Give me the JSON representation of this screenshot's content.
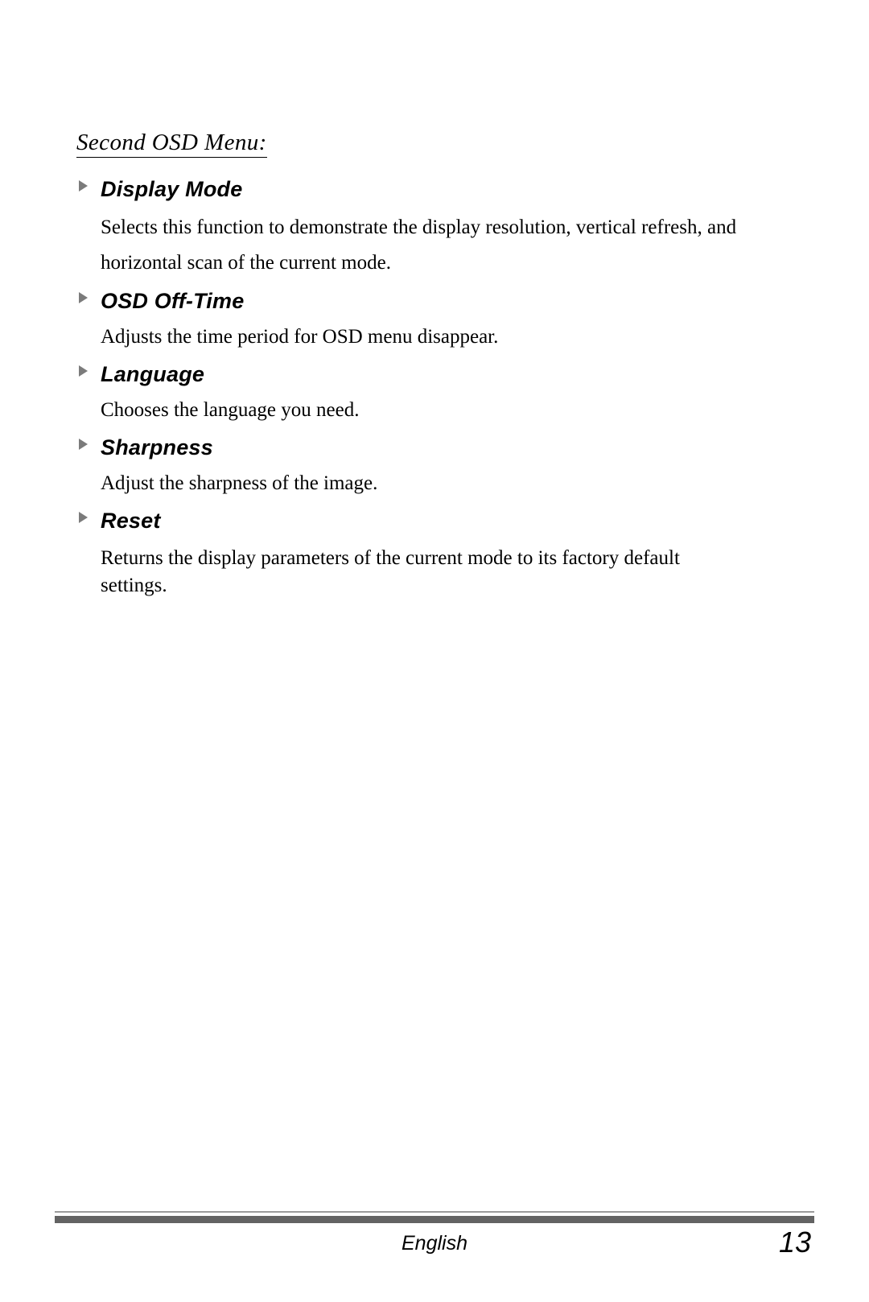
{
  "document": {
    "section_title": "Second OSD Menu:",
    "entries": [
      {
        "heading": "Display Mode",
        "body": "Selects this function to demonstrate the display resolution, vertical refresh, and horizontal scan of the current mode.",
        "bullet": "triangle-right-icon"
      },
      {
        "heading": "OSD Off-Time",
        "body": "Adjusts the time period for OSD menu disappear.",
        "bullet": "triangle-right-icon"
      },
      {
        "heading": "Language",
        "body": "Chooses the language you need.",
        "bullet": "triangle-right-icon"
      },
      {
        "heading": "Sharpness",
        "body": "Adjust the sharpness of the image.",
        "bullet": "triangle-right-icon"
      },
      {
        "heading": "Reset",
        "body": "Returns the display parameters of the current mode to its factory default settings.",
        "bullet": "triangle-right-icon"
      }
    ]
  },
  "footer": {
    "language": "English",
    "page_number": "13"
  },
  "colors": {
    "text": "#000000",
    "bullet_gray": "#7b7b7b",
    "rule_thin": "#9b9b9b",
    "rule_thick": "#636363",
    "page_background": "#ffffff"
  }
}
